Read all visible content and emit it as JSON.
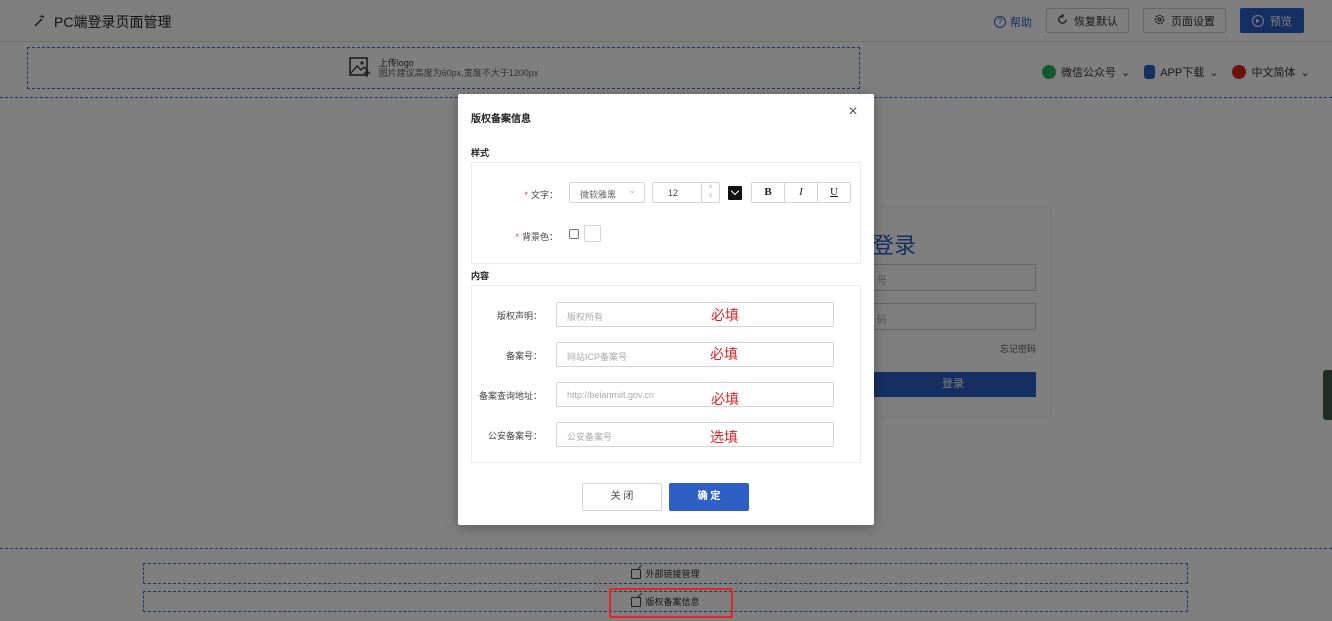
{
  "topbar": {
    "title": "PC端登录页面管理",
    "help": "帮助",
    "restore": "恢复默认",
    "page_settings": "页面设置",
    "preview": "预览"
  },
  "logo_upload": {
    "label": "上传logo",
    "hint": "图片建议高度为60px,宽度不大于1200px"
  },
  "header_links": {
    "wechat": "微信公众号",
    "app": "APP下载",
    "language": "中文简体"
  },
  "login_card": {
    "title": "登录",
    "username_placeholder": "号",
    "password_placeholder": "码",
    "forgot": "忘记密码",
    "login_button": "登录"
  },
  "footer": {
    "external_links": "外部链接管理",
    "copyright_info": "版权备案信息"
  },
  "modal": {
    "title": "版权备案信息",
    "style_section": "样式",
    "content_section": "内容",
    "font_label": "文字：",
    "font_family": "微软雅黑",
    "font_size": "12",
    "text_color": "#111111",
    "bold": "B",
    "italic": "I",
    "underline": "U",
    "bg_label": "背景色：",
    "copyright_label": "版权声明：",
    "copyright_placeholder": "版权所有",
    "copyright_note": "必填",
    "icp_label": "备案号：",
    "icp_placeholder": "网站ICP备案号",
    "icp_note": "必填",
    "query_label": "备案查询地址：",
    "query_placeholder": "http://beianmiit.gov.cn",
    "query_note": "必填",
    "police_label": "公安备案号：",
    "police_placeholder": "公安备案号",
    "police_note": "选填",
    "close_button": "关 闭",
    "confirm_button": "确 定"
  }
}
